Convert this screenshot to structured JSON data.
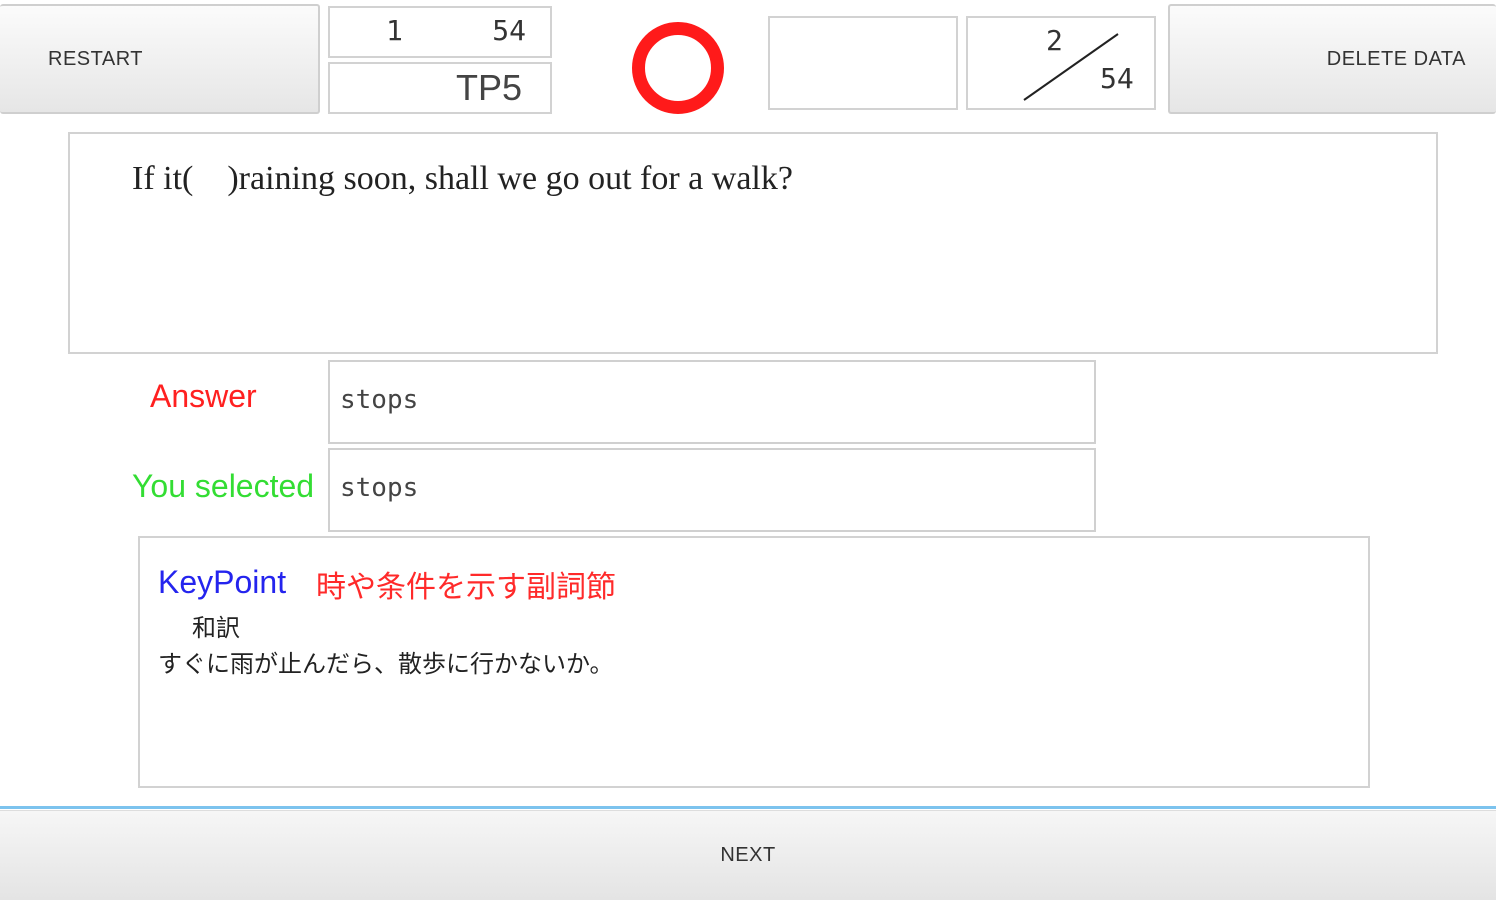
{
  "toolbar": {
    "restart_label": "RESTART",
    "delete_label": "DELETE DATA"
  },
  "counter": {
    "current": "1",
    "total": "54",
    "set_name": "TP5"
  },
  "result": {
    "mark": "circle-correct",
    "mark_color": "#ff1a1a"
  },
  "progress": {
    "numerator": "2",
    "denominator": "54"
  },
  "question": {
    "text": "If it(    )raining soon, shall we go out for a walk?"
  },
  "answer": {
    "label": "Answer",
    "value": "stops",
    "label_color": "#ff2020"
  },
  "selected": {
    "label": "You selected",
    "value": "stops",
    "label_color": "#33dd33"
  },
  "keypoint": {
    "title": "KeyPoint",
    "topic": "時や条件を示す副詞節",
    "translation_label": "和訳",
    "translation": "すぐに雨が止んだら、散歩に行かないか。"
  },
  "footer": {
    "next_label": "NEXT"
  }
}
